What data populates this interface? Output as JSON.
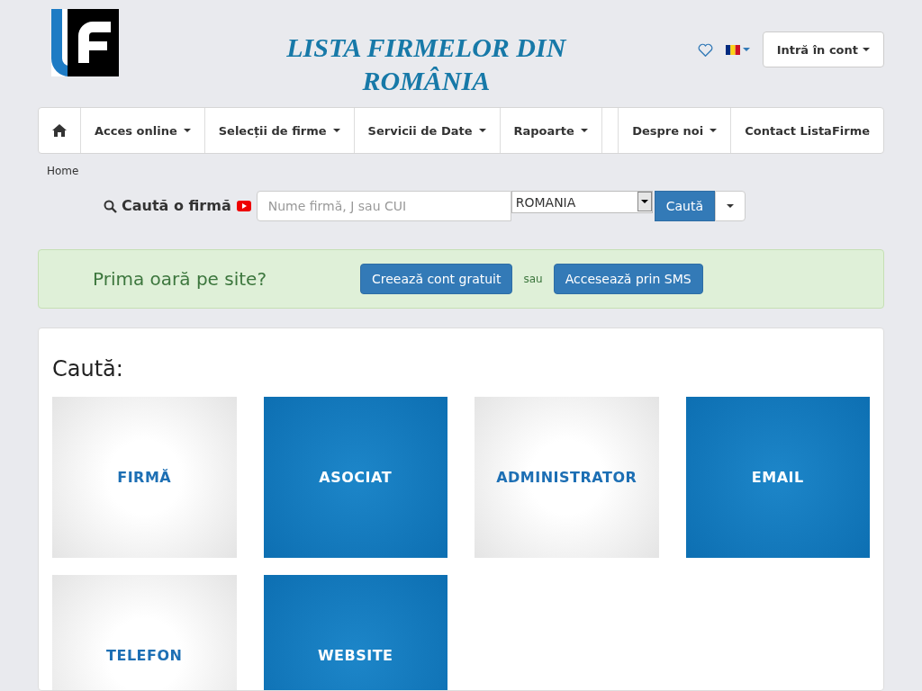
{
  "header": {
    "title": "LISTA FIRMELOR DIN ROMÂNIA",
    "login_button": "Intră în cont"
  },
  "nav": {
    "left": [
      {
        "label": "Acces online",
        "dropdown": true
      },
      {
        "label": "Selecții de firme",
        "dropdown": true
      },
      {
        "label": "Servicii de Date",
        "dropdown": true
      },
      {
        "label": "Rapoarte",
        "dropdown": true
      }
    ],
    "right": [
      {
        "label": "Despre noi",
        "dropdown": true
      },
      {
        "label": "Contact ListaFirme",
        "dropdown": false
      }
    ]
  },
  "breadcrumb": "Home",
  "search": {
    "label": "Caută o firmă",
    "placeholder": "Nume firmă, J sau CUI",
    "country": "ROMANIA",
    "button": "Caută"
  },
  "alert": {
    "text": "Prima oară pe site?",
    "primary_button": "Creează cont gratuit",
    "separator": "sau",
    "secondary_button": "Accesează prin SMS"
  },
  "panel": {
    "heading": "Caută:",
    "tiles": [
      {
        "label": "FIRMĂ",
        "kind": "light"
      },
      {
        "label": "ASOCIAT",
        "kind": "dark"
      },
      {
        "label": "ADMINISTRATOR",
        "kind": "light"
      },
      {
        "label": "EMAIL",
        "kind": "dark"
      },
      {
        "label": "TELEFON",
        "kind": "light"
      },
      {
        "label": "WEBSITE",
        "kind": "dark"
      }
    ]
  }
}
